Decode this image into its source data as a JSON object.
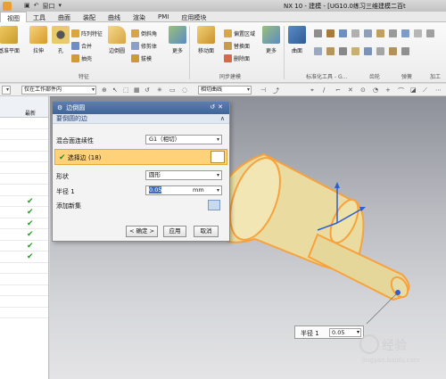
{
  "titlebar": {
    "window_title": "NX 10 - 建模 - [UG10.0练习三维建模二百t",
    "quick_access_window": "窗口"
  },
  "menubar": {
    "items": [
      "视图",
      "工具",
      "曲面",
      "装配",
      "曲线",
      "渲染",
      "PMI",
      "应用模块"
    ]
  },
  "ribbon": {
    "datum_plane": "基准平面",
    "extrude": "拉伸",
    "hole": "孔",
    "pattern_feature": "阵列特征",
    "unite": "合并",
    "shell": "抽壳",
    "edge_blend": "边倒圆",
    "chamfer": "倒斜角",
    "trim_body": "修剪体",
    "draft": "拔模",
    "more1": "更多",
    "move_face": "移动面",
    "offset_region": "偏置区域",
    "replace_face": "替换面",
    "delete_face": "删除面",
    "more2": "更多",
    "surface": "曲面",
    "groups": {
      "feature": "特征",
      "sync_modeling": "同步建模",
      "standard_tools": "标准化工具 - G...",
      "gear": "齿轮",
      "spring": "弹簧",
      "machining": "加工"
    }
  },
  "filterbar": {
    "scope": "仅在工作部件内",
    "curve_rule": "相切曲线"
  },
  "navigator": {
    "column_latest": "最新",
    "checked_rows": [
      7,
      8,
      9,
      10,
      11,
      12
    ]
  },
  "dialog": {
    "title": "边倒圆",
    "section_edges": "要倒圆的边",
    "continuity_label": "混合面连续性",
    "continuity_value": "G1（相切）",
    "select_edges": "选择边 (18)",
    "shape_label": "形状",
    "shape_value": "圆形",
    "radius_label": "半径 1",
    "radius_value": "0.05",
    "radius_unit": "mm",
    "add_new_set": "添加新集",
    "ok": "< 确定 >",
    "apply": "应用",
    "cancel": "取消"
  },
  "float_ctrl": {
    "label": "半径 1",
    "value": "0.05"
  },
  "watermark": {
    "brand": "经验",
    "site": "jingyan.baidu.com"
  },
  "colors": {
    "highlight_edge": "#f7a23c",
    "part_face": "#eadca0",
    "dialog_title": "#4a6fa5",
    "selection_row": "#ffd27a"
  }
}
